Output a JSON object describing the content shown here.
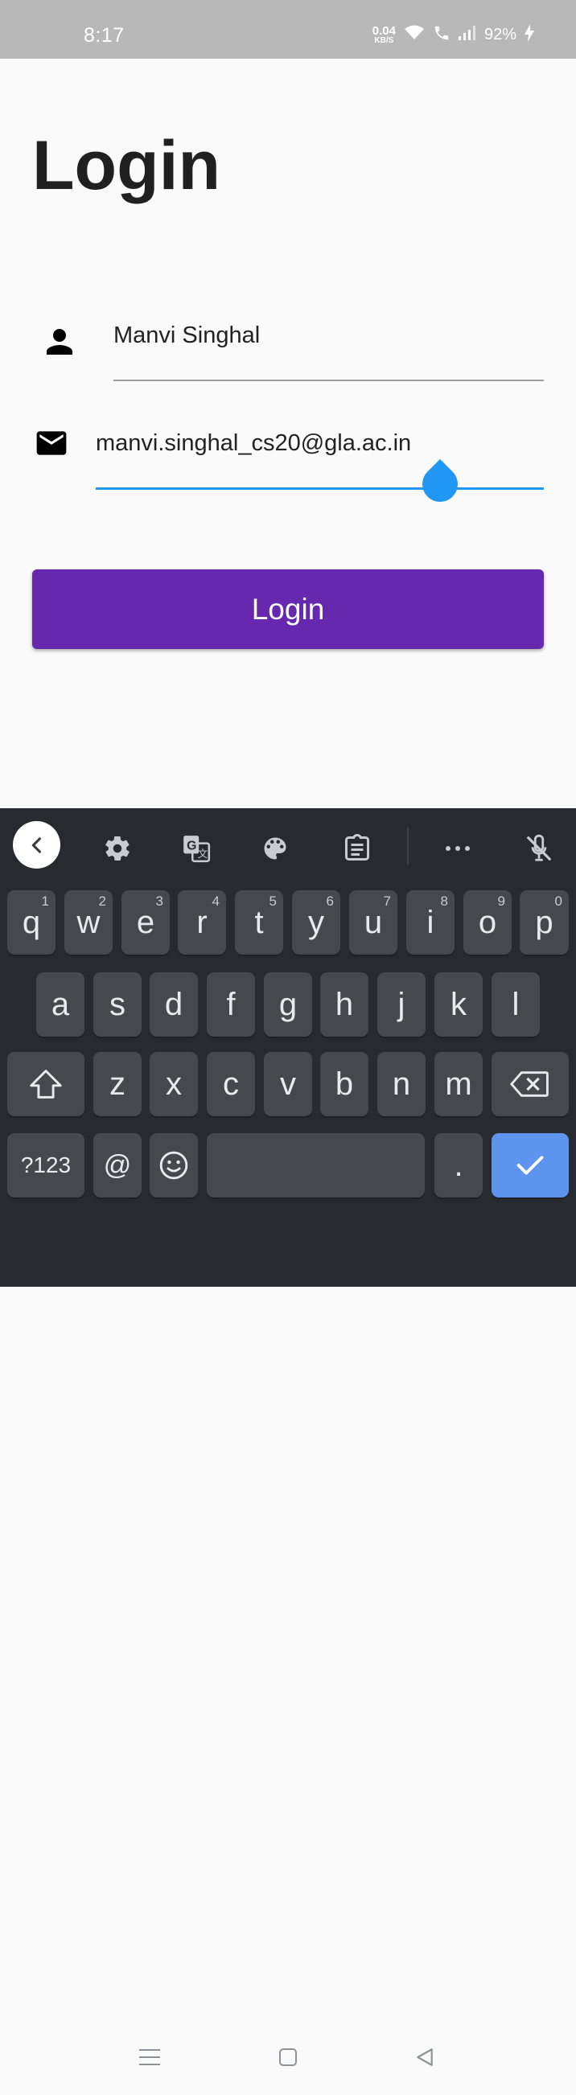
{
  "status_bar": {
    "time": "8:17",
    "net_speed_value": "0.04",
    "net_speed_unit": "KB/S",
    "battery": "92%"
  },
  "login_page": {
    "title": "Login",
    "name_field": {
      "value": "Manvi Singhal",
      "icon": "person-icon"
    },
    "email_field": {
      "value": "manvi.singhal_cs20@gla.ac.in",
      "icon": "mail-icon",
      "focused": true
    },
    "login_button_label": "Login",
    "accent_color": "#6528ae",
    "focus_color": "#2196f3"
  },
  "keyboard": {
    "toolbar": [
      "back-icon",
      "settings-icon",
      "translate-icon",
      "palette-icon",
      "clipboard-icon",
      "more-icon",
      "mic-off-icon"
    ],
    "row1": [
      {
        "label": "q",
        "hint": "1"
      },
      {
        "label": "w",
        "hint": "2"
      },
      {
        "label": "e",
        "hint": "3"
      },
      {
        "label": "r",
        "hint": "4"
      },
      {
        "label": "t",
        "hint": "5"
      },
      {
        "label": "y",
        "hint": "6"
      },
      {
        "label": "u",
        "hint": "7"
      },
      {
        "label": "i",
        "hint": "8"
      },
      {
        "label": "o",
        "hint": "9"
      },
      {
        "label": "p",
        "hint": "0"
      }
    ],
    "row2": [
      "a",
      "s",
      "d",
      "f",
      "g",
      "h",
      "j",
      "k",
      "l"
    ],
    "row3": [
      "z",
      "x",
      "c",
      "v",
      "b",
      "n",
      "m"
    ],
    "row4": {
      "symbols": "?123",
      "at": "@",
      "period": "."
    },
    "enter_color": "#5d95ee"
  },
  "navbar": [
    "menu-icon",
    "home-icon",
    "back-triangle-icon"
  ]
}
